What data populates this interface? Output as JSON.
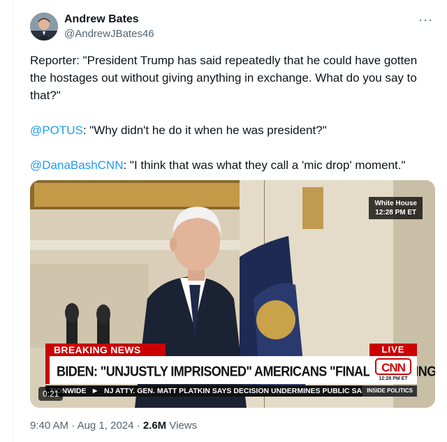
{
  "author": {
    "name": "Andrew Bates",
    "handle": "@AndrewJBates46"
  },
  "menu_icon": "more-horizontal-icon",
  "tweet": {
    "line1": "Reporter: \"President Trump has said repeatedly that he could have gotten the hostages out without giving anything in exchange. What do you say to that?\"",
    "potus_mention": "@POTUS",
    "potus_text": ": \"Why didn't he do it when he was president?\"",
    "dana_mention": "@DanaBashCNN",
    "dana_text": ": \"I think that was what they call a 'mic drop' moment.\""
  },
  "video": {
    "location_label": "White House",
    "location_time": "12:28 PM ET",
    "breaking_label": "BREAKING NEWS",
    "live_label": "LIVE",
    "headline": "BIDEN: \"UNJUSTLY IMPRISONED\" AMERICANS \"FINALLY COMING HOME\"",
    "network_logo": "CNN",
    "network_time": "12:28 PM ET",
    "ticker_prefix": "TIONWIDE",
    "ticker_text": "NJ ATTY. GEN. MATT PLATKIN SAYS DECISION UNDERMINES PUBLIC SAFE",
    "ticker_show": "INSIDE POLITICS",
    "duration": "0:21"
  },
  "meta": {
    "time": "9:40 AM",
    "date": "Aug 1, 2024",
    "views_count": "2.6M",
    "views_label": "Views"
  },
  "colors": {
    "link": "#1d9bf0",
    "cnn_red": "#cc0000",
    "secondary_text": "#536471"
  }
}
